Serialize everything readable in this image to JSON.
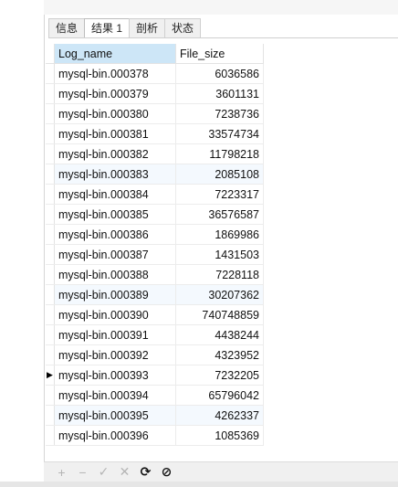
{
  "tabs": [
    {
      "label": "信息"
    },
    {
      "label": "结果 1"
    },
    {
      "label": "剖析"
    },
    {
      "label": "状态"
    }
  ],
  "columns": {
    "col1": "Log_name",
    "col2": "File_size"
  },
  "rows": [
    {
      "log_name": "mysql-bin.000378",
      "file_size": "6036586"
    },
    {
      "log_name": "mysql-bin.000379",
      "file_size": "3601131"
    },
    {
      "log_name": "mysql-bin.000380",
      "file_size": "7238736"
    },
    {
      "log_name": "mysql-bin.000381",
      "file_size": "33574734"
    },
    {
      "log_name": "mysql-bin.000382",
      "file_size": "11798218"
    },
    {
      "log_name": "mysql-bin.000383",
      "file_size": "2085108"
    },
    {
      "log_name": "mysql-bin.000384",
      "file_size": "7223317"
    },
    {
      "log_name": "mysql-bin.000385",
      "file_size": "36576587"
    },
    {
      "log_name": "mysql-bin.000386",
      "file_size": "1869986"
    },
    {
      "log_name": "mysql-bin.000387",
      "file_size": "1431503"
    },
    {
      "log_name": "mysql-bin.000388",
      "file_size": "7228118"
    },
    {
      "log_name": "mysql-bin.000389",
      "file_size": "30207362"
    },
    {
      "log_name": "mysql-bin.000390",
      "file_size": "740748859"
    },
    {
      "log_name": "mysql-bin.000391",
      "file_size": "4438244"
    },
    {
      "log_name": "mysql-bin.000392",
      "file_size": "4323952"
    },
    {
      "log_name": "mysql-bin.000393",
      "file_size": "7232205"
    },
    {
      "log_name": "mysql-bin.000394",
      "file_size": "65796042"
    },
    {
      "log_name": "mysql-bin.000395",
      "file_size": "4262337"
    },
    {
      "log_name": "mysql-bin.000396",
      "file_size": "1085369"
    }
  ],
  "current_row_marker": "▶",
  "toolbar": {
    "add": "+",
    "remove": "−",
    "apply": "✓",
    "discard": "✕",
    "refresh": "⟳",
    "stop": "⊘"
  }
}
